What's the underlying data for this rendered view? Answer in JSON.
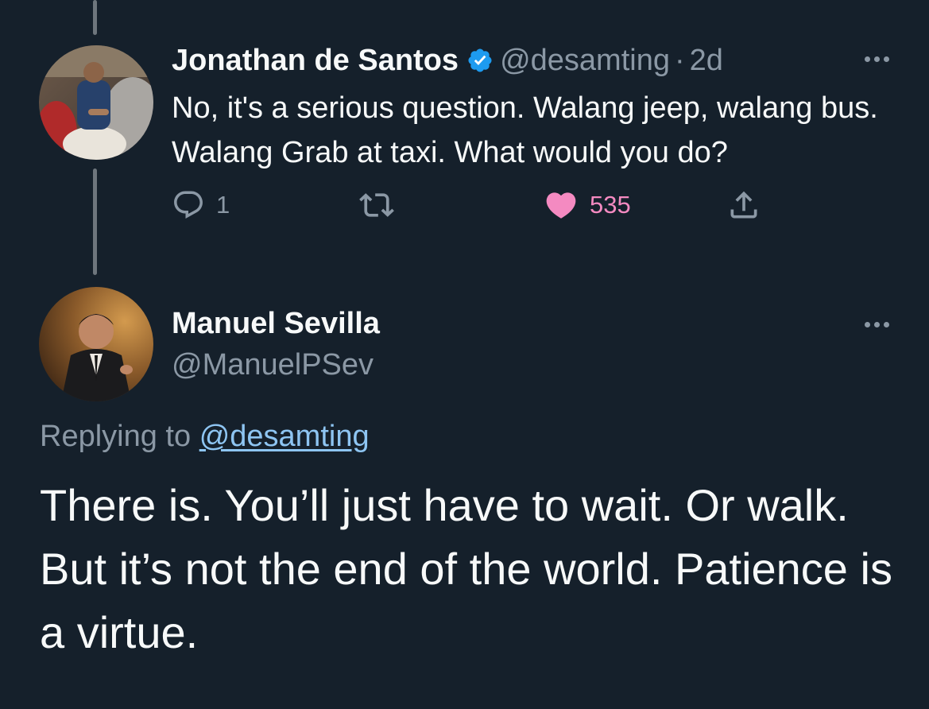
{
  "parent_tweet": {
    "author_name": "Jonathan de Santos",
    "handle": "@desamting",
    "separator": "·",
    "time": "2d",
    "text": "No, it's a serious question. Walang jeep, walang bus. Walang Grab at taxi. What would you do?",
    "reply_count": "1",
    "like_count": "535",
    "liked": true,
    "verified": true
  },
  "reply_tweet": {
    "author_name": "Manuel Sevilla",
    "handle": "@ManuelPSev",
    "replying_prefix": "Replying to",
    "replying_handle": "@desamting",
    "text": "There is. You’ll just have to wait. Or walk. But it’s not the end of the world. Patience is a virtue."
  },
  "colors": {
    "background": "#15202b",
    "text": "#f7f9f9",
    "secondary": "#8b98a5",
    "like": "#f91880",
    "link": "#8ec5f2",
    "verified": "#1d9bf0"
  },
  "icons": {
    "verified": "verified-badge-icon",
    "more": "more-icon",
    "reply": "reply-icon",
    "retweet": "retweet-icon",
    "like": "heart-icon",
    "share": "share-icon"
  }
}
